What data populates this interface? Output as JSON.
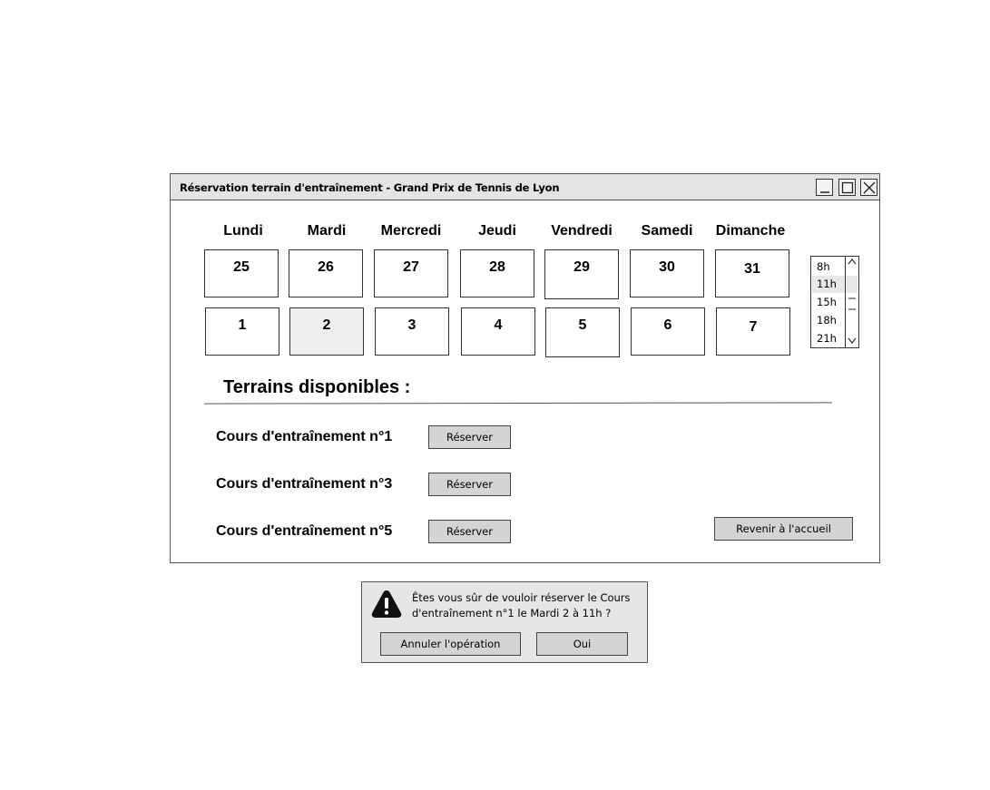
{
  "window": {
    "title": "Réservation terrain d'entraînement - Grand Prix de Tennis de Lyon"
  },
  "days": [
    "Lundi",
    "Mardi",
    "Mercredi",
    "Jeudi",
    "Vendredi",
    "Samedi",
    "Dimanche"
  ],
  "week1": [
    "25",
    "26",
    "27",
    "28",
    "29",
    "30",
    "31"
  ],
  "week2": [
    "1",
    "2",
    "3",
    "4",
    "5",
    "6",
    "7"
  ],
  "selected_date": "2",
  "hours": [
    "8h",
    "11h",
    "15h",
    "18h",
    "21h"
  ],
  "selected_hour": "11h",
  "section_title": "Terrains disponibles :",
  "courts": [
    {
      "label": "Cours d'entraînement n°1",
      "button": "Réserver"
    },
    {
      "label": "Cours d'entraînement n°3",
      "button": "Réserver"
    },
    {
      "label": "Cours d'entraînement n°5",
      "button": "Réserver"
    }
  ],
  "back_button": "Revenir à l'accueil",
  "dialog": {
    "icon": "warning-icon",
    "message": "Êtes vous sûr de vouloir réserver le Cours d'entraînement n°1 le Mardi 2 à 11h ?",
    "cancel_label": "Annuler l'opération",
    "confirm_label": "Oui"
  },
  "colors": {
    "titlebar": "#e4e4e4",
    "button": "#d4d4d4",
    "selected": "#eeeeee",
    "dialog": "#e6e6e6"
  }
}
